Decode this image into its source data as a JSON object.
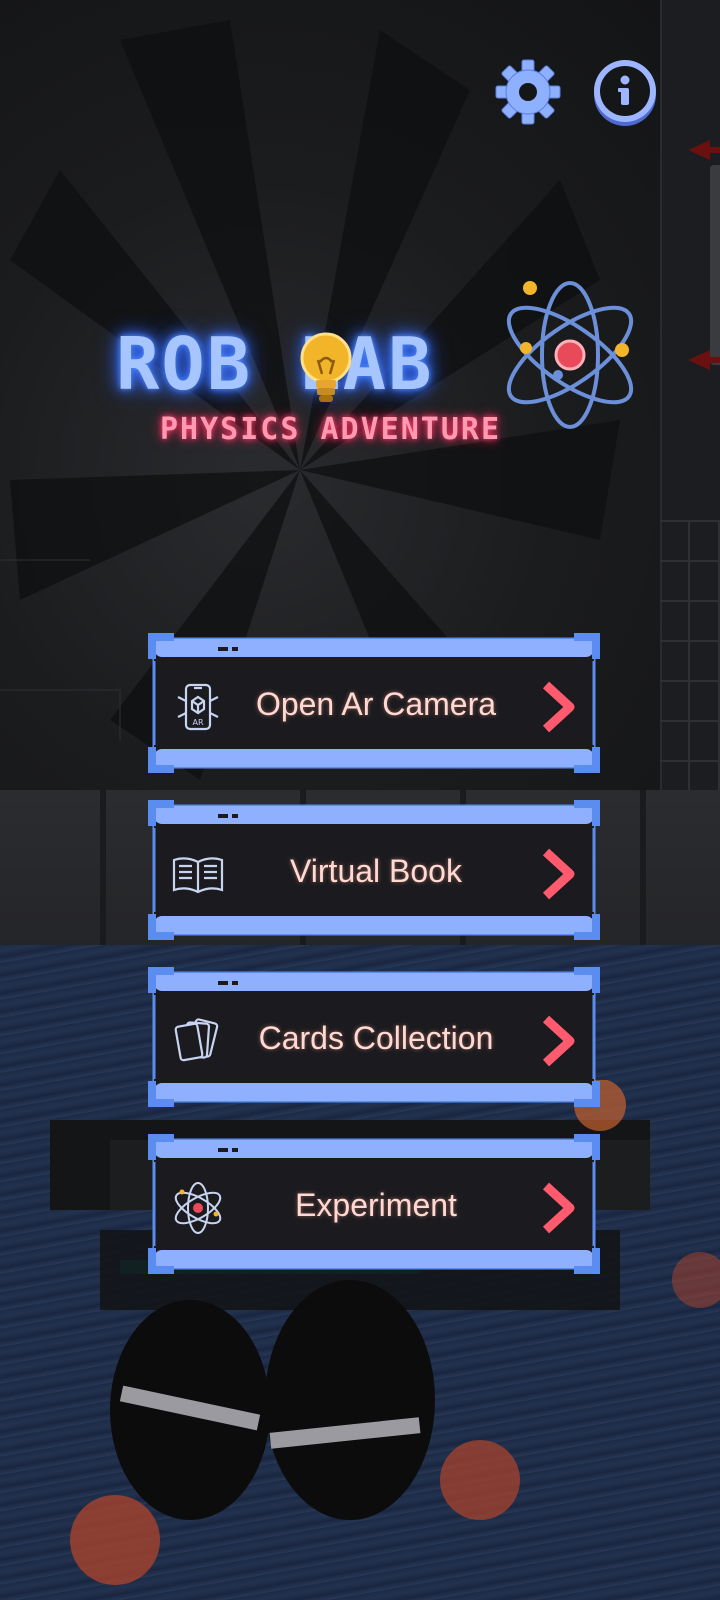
{
  "app": {
    "title": "ROB LAB",
    "subtitle": "PHYSICS ADVENTURE"
  },
  "header": {
    "icons": [
      "gear-icon",
      "info-icon"
    ]
  },
  "menu": {
    "items": [
      {
        "label": "Open Ar Camera",
        "icon": "ar-phone-icon"
      },
      {
        "label": "Virtual Book",
        "icon": "book-icon"
      },
      {
        "label": "Cards Collection",
        "icon": "cards-icon"
      },
      {
        "label": "Experiment",
        "icon": "atom-icon"
      }
    ]
  },
  "colors": {
    "frame_blue": "#5b8cf0",
    "frame_light": "#8fb0ff",
    "button_fill": "#1b1b1f",
    "label": "#ffd9d2",
    "chevron": "#ff5a6e",
    "title_glow": "#4f8bff",
    "subtitle_glow": "#ff3d6e"
  }
}
